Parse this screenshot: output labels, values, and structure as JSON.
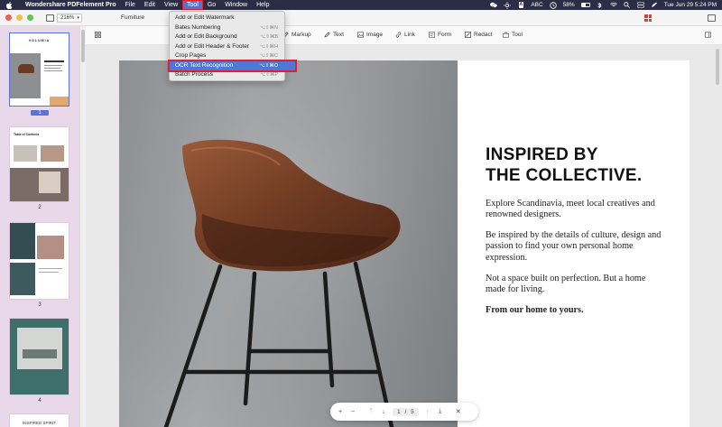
{
  "menubar": {
    "app_name": "Wondershare PDFelement Pro",
    "items": [
      "File",
      "Edit",
      "View",
      "Tool",
      "Go",
      "Window",
      "Help"
    ],
    "active_item": "Tool",
    "battery_percent": "58%",
    "battery_level": 0.58,
    "input_source": "ABC",
    "datetime": "Tue Jun 29  5:24 PM"
  },
  "window": {
    "zoom_level": "216%",
    "document_tab": "Furniture"
  },
  "toolbar": {
    "markup": "Markup",
    "text": "Text",
    "image": "Image",
    "link": "Link",
    "form": "Form",
    "redact": "Redact",
    "tool": "Tool"
  },
  "tool_menu": [
    {
      "label": "Add or Edit Watermark",
      "shortcut": ""
    },
    {
      "label": "Bates Numbering",
      "shortcut": "⌥⇧⌘N"
    },
    {
      "label": "Add or Edit Background",
      "shortcut": "⌥⇧⌘B"
    },
    {
      "label": "Add or Edit Header & Footer",
      "shortcut": "⌥⇧⌘H"
    },
    {
      "label": "Crop Pages",
      "shortcut": "⌥⇧⌘C"
    },
    {
      "label": "OCR Text Recognition",
      "shortcut": "⌥⇧⌘O"
    },
    {
      "label": "Batch Process",
      "shortcut": "⌥⇧⌘P"
    }
  ],
  "thumbnails": {
    "pages": [
      "1",
      "2",
      "3",
      "4"
    ],
    "selected": "1",
    "p1_brand": "VOLUMIA",
    "p2_title": "Table of Contents",
    "p5_title": "INSPIRED SPIRIT"
  },
  "document": {
    "heading_line1": "INSPIRED BY",
    "heading_line2": "THE COLLECTIVE.",
    "para1": "Explore Scandinavia, meet local creatives and renowned designers.",
    "para2": "Be inspired by the details of culture, design and passion to find your own personal home expression.",
    "para3": "Not a space built on perfection. But a home made for living.",
    "para4": "From our home to yours."
  },
  "page_nav": {
    "current": "1",
    "separator": "/",
    "total": "5"
  }
}
